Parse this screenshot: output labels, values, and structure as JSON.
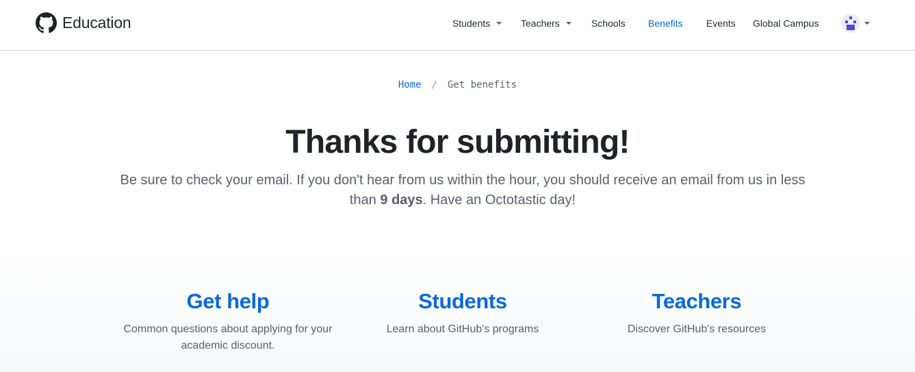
{
  "header": {
    "brand": "Education",
    "nav": [
      {
        "label": "Students",
        "dropdown": true
      },
      {
        "label": "Teachers",
        "dropdown": true
      },
      {
        "label": "Schools",
        "dropdown": false
      },
      {
        "label": "Benefits",
        "dropdown": false,
        "active": true
      },
      {
        "label": "Events",
        "dropdown": false
      },
      {
        "label": "Global Campus",
        "dropdown": false
      }
    ],
    "avatar_icon": "user-identicon"
  },
  "breadcrumb": {
    "home": "Home",
    "separator": "/",
    "current": "Get benefits"
  },
  "main": {
    "title": "Thanks for submitting!",
    "lead_before": "Be sure to check your email. If you don't hear from us within the hour, you should receive an email from us in less than ",
    "lead_bold": "9 days",
    "lead_after": ". Have an Octotastic day!"
  },
  "cards": [
    {
      "title": "Get help",
      "text": "Common questions about applying for your academic discount."
    },
    {
      "title": "Students",
      "text": "Learn about GitHub's programs"
    },
    {
      "title": "Teachers",
      "text": "Discover GitHub's resources"
    }
  ],
  "colors": {
    "link": "#0969da",
    "text": "#24292f",
    "muted": "#57606a",
    "avatar": "#4f46d6"
  }
}
